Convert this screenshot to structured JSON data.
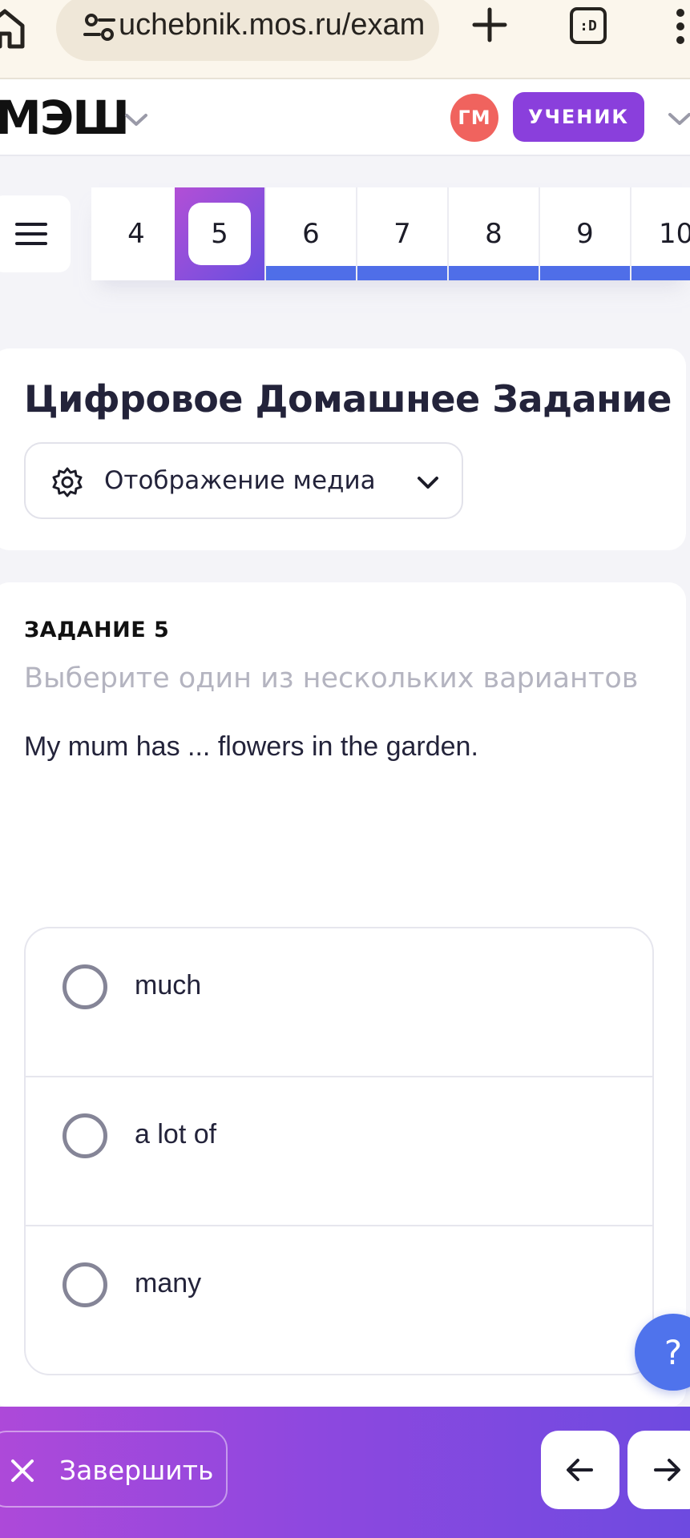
{
  "browser": {
    "url": "uchebnik.mos.ru/exam",
    "tabs_badge": ":D"
  },
  "header": {
    "logo": "МЭШ",
    "avatar_initials": "ГМ",
    "role": "УЧЕНИК"
  },
  "navigator": {
    "tasks": [
      {
        "label": "4",
        "state": "plain"
      },
      {
        "label": "5",
        "state": "active"
      },
      {
        "label": "6",
        "state": "done"
      },
      {
        "label": "7",
        "state": "done"
      },
      {
        "label": "8",
        "state": "done"
      },
      {
        "label": "9",
        "state": "done"
      },
      {
        "label": "10",
        "state": "done"
      }
    ]
  },
  "title_card": {
    "title": "Цифровое Домашнее Задание",
    "media_button": "Отображение медиа"
  },
  "question": {
    "number": "ЗАДАНИЕ 5",
    "instruction": "Выберите один из нескольких вариантов",
    "text": "My mum has ... flowers in the garden.",
    "options": [
      "much",
      "a lot of",
      "many"
    ]
  },
  "help": {
    "label": "?"
  },
  "bottom_bar": {
    "finish_label": "Завершить"
  },
  "colors": {
    "accent_purple": "#8a3fdc",
    "progress_blue": "#4f6ee8",
    "avatar_red": "#f0635e"
  }
}
